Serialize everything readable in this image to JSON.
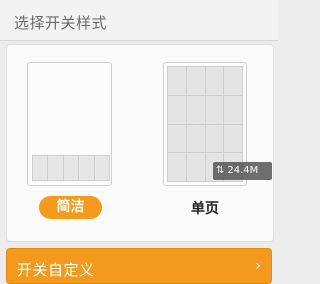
{
  "header": {
    "title": "选择开关样式"
  },
  "options": {
    "simple": {
      "label": "简洁",
      "selected": true
    },
    "single_page": {
      "label": "单页",
      "selected": false
    }
  },
  "net_speed": {
    "icon": "updown-arrows-icon",
    "icon_glyph": "⇅",
    "value": "24.4M"
  },
  "action": {
    "label": "开关自定义",
    "chevron": "›"
  },
  "colors": {
    "accent": "#f59a1c",
    "background": "#ececec"
  }
}
